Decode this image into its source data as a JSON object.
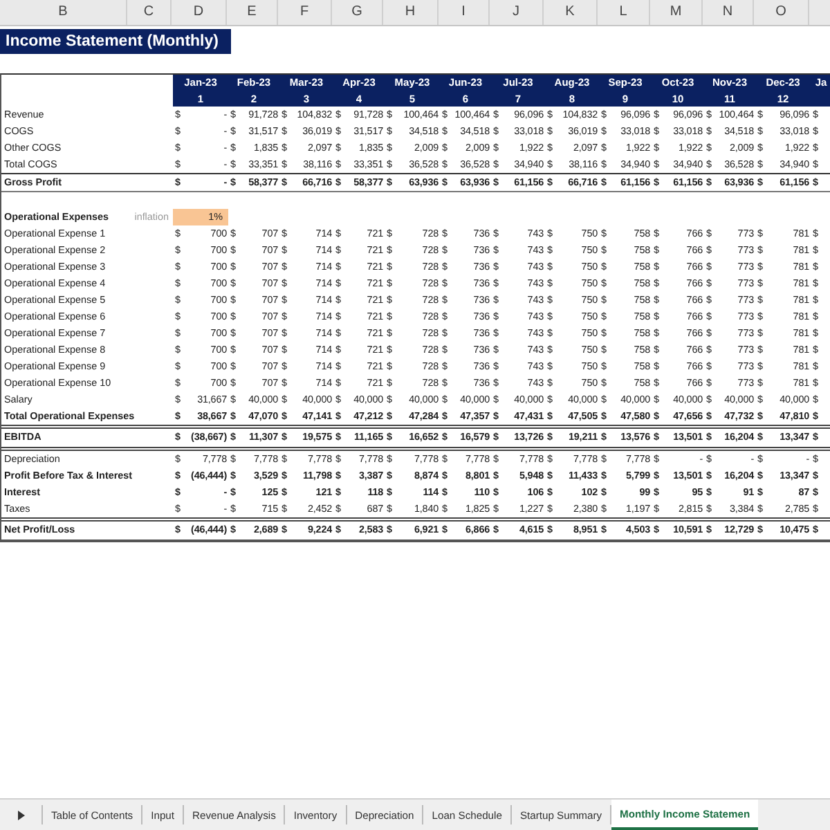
{
  "column_letters": [
    "B",
    "C",
    "D",
    "E",
    "F",
    "G",
    "H",
    "I",
    "J",
    "K",
    "L",
    "M",
    "N",
    "O"
  ],
  "title": "Income Statement (Monthly)",
  "table": {
    "months": [
      "Jan-23",
      "Feb-23",
      "Mar-23",
      "Apr-23",
      "May-23",
      "Jun-23",
      "Jul-23",
      "Aug-23",
      "Sep-23",
      "Oct-23",
      "Nov-23",
      "Dec-23",
      "Ja"
    ],
    "periods": [
      "1",
      "2",
      "3",
      "4",
      "5",
      "6",
      "7",
      "8",
      "9",
      "10",
      "11",
      "12"
    ],
    "rows": [
      {
        "label": "Revenue",
        "kind": "plain",
        "cells": [
          "$ -",
          "$ 91,728",
          "$ 104,832",
          "$ 91,728",
          "$ 100,464",
          "$ 100,464",
          "$ 96,096",
          "$ 104,832",
          "$ 96,096",
          "$ 96,096",
          "$ 100,464",
          "$ 96,096",
          "$"
        ]
      },
      {
        "label": "COGS",
        "kind": "plain",
        "cells": [
          "$ -",
          "$ 31,517",
          "$ 36,019",
          "$ 31,517",
          "$ 34,518",
          "$ 34,518",
          "$ 33,018",
          "$ 36,019",
          "$ 33,018",
          "$ 33,018",
          "$ 34,518",
          "$ 33,018",
          "$"
        ]
      },
      {
        "label": "Other COGS",
        "kind": "plain",
        "cells": [
          "$ -",
          "$ 1,835",
          "$ 2,097",
          "$ 1,835",
          "$ 2,009",
          "$ 2,009",
          "$ 1,922",
          "$ 2,097",
          "$ 1,922",
          "$ 1,922",
          "$ 2,009",
          "$ 1,922",
          "$"
        ]
      },
      {
        "label": "Total COGS",
        "kind": "plain",
        "cells": [
          "$ -",
          "$ 33,351",
          "$ 38,116",
          "$ 33,351",
          "$ 36,528",
          "$ 36,528",
          "$ 34,940",
          "$ 38,116",
          "$ 34,940",
          "$ 34,940",
          "$ 36,528",
          "$ 34,940",
          "$"
        ]
      },
      {
        "label": "Gross Profit",
        "kind": "total",
        "cells": [
          "$ -",
          "$ 58,377",
          "$ 66,716",
          "$ 58,377",
          "$ 63,936",
          "$ 63,936",
          "$ 61,156",
          "$ 66,716",
          "$ 61,156",
          "$ 61,156",
          "$ 63,936",
          "$ 61,156",
          "$"
        ]
      },
      {
        "label": "Operational Expenses",
        "kind": "section",
        "note": "inflation",
        "input": "1%"
      },
      {
        "label": "Operational Expense 1",
        "kind": "plain",
        "cells": [
          "$ 700",
          "$ 707",
          "$ 714",
          "$ 721",
          "$ 728",
          "$ 736",
          "$ 743",
          "$ 750",
          "$ 758",
          "$ 766",
          "$ 773",
          "$ 781",
          "$"
        ]
      },
      {
        "label": "Operational Expense 2",
        "kind": "plain",
        "cells": [
          "$ 700",
          "$ 707",
          "$ 714",
          "$ 721",
          "$ 728",
          "$ 736",
          "$ 743",
          "$ 750",
          "$ 758",
          "$ 766",
          "$ 773",
          "$ 781",
          "$"
        ]
      },
      {
        "label": "Operational Expense 3",
        "kind": "plain",
        "cells": [
          "$ 700",
          "$ 707",
          "$ 714",
          "$ 721",
          "$ 728",
          "$ 736",
          "$ 743",
          "$ 750",
          "$ 758",
          "$ 766",
          "$ 773",
          "$ 781",
          "$"
        ]
      },
      {
        "label": "Operational Expense 4",
        "kind": "plain",
        "cells": [
          "$ 700",
          "$ 707",
          "$ 714",
          "$ 721",
          "$ 728",
          "$ 736",
          "$ 743",
          "$ 750",
          "$ 758",
          "$ 766",
          "$ 773",
          "$ 781",
          "$"
        ]
      },
      {
        "label": "Operational Expense 5",
        "kind": "plain",
        "cells": [
          "$ 700",
          "$ 707",
          "$ 714",
          "$ 721",
          "$ 728",
          "$ 736",
          "$ 743",
          "$ 750",
          "$ 758",
          "$ 766",
          "$ 773",
          "$ 781",
          "$"
        ]
      },
      {
        "label": "Operational Expense 6",
        "kind": "plain",
        "cells": [
          "$ 700",
          "$ 707",
          "$ 714",
          "$ 721",
          "$ 728",
          "$ 736",
          "$ 743",
          "$ 750",
          "$ 758",
          "$ 766",
          "$ 773",
          "$ 781",
          "$"
        ]
      },
      {
        "label": "Operational Expense 7",
        "kind": "plain",
        "cells": [
          "$ 700",
          "$ 707",
          "$ 714",
          "$ 721",
          "$ 728",
          "$ 736",
          "$ 743",
          "$ 750",
          "$ 758",
          "$ 766",
          "$ 773",
          "$ 781",
          "$"
        ]
      },
      {
        "label": "Operational Expense 8",
        "kind": "plain",
        "cells": [
          "$ 700",
          "$ 707",
          "$ 714",
          "$ 721",
          "$ 728",
          "$ 736",
          "$ 743",
          "$ 750",
          "$ 758",
          "$ 766",
          "$ 773",
          "$ 781",
          "$"
        ]
      },
      {
        "label": "Operational Expense 9",
        "kind": "plain",
        "cells": [
          "$ 700",
          "$ 707",
          "$ 714",
          "$ 721",
          "$ 728",
          "$ 736",
          "$ 743",
          "$ 750",
          "$ 758",
          "$ 766",
          "$ 773",
          "$ 781",
          "$"
        ]
      },
      {
        "label": "Operational Expense 10",
        "kind": "plain",
        "cells": [
          "$ 700",
          "$ 707",
          "$ 714",
          "$ 721",
          "$ 728",
          "$ 736",
          "$ 743",
          "$ 750",
          "$ 758",
          "$ 766",
          "$ 773",
          "$ 781",
          "$"
        ]
      },
      {
        "label": "Salary",
        "kind": "plain",
        "cells": [
          "$ 31,667",
          "$ 40,000",
          "$ 40,000",
          "$ 40,000",
          "$ 40,000",
          "$ 40,000",
          "$ 40,000",
          "$ 40,000",
          "$ 40,000",
          "$ 40,000",
          "$ 40,000",
          "$ 40,000",
          "$"
        ]
      },
      {
        "label": "Total Operational Expenses",
        "kind": "bold",
        "cells": [
          "$ 38,667",
          "$ 47,070",
          "$ 47,141",
          "$ 47,212",
          "$ 47,284",
          "$ 47,357",
          "$ 47,431",
          "$ 47,505",
          "$ 47,580",
          "$ 47,656",
          "$ 47,732",
          "$ 47,810",
          "$"
        ]
      },
      {
        "label": "EBITDA",
        "kind": "double",
        "cells": [
          "$ (38,667)",
          "$ 11,307",
          "$ 19,575",
          "$ 11,165",
          "$ 16,652",
          "$ 16,579",
          "$ 13,726",
          "$ 19,211",
          "$ 13,576",
          "$ 13,501",
          "$ 16,204",
          "$ 13,347",
          "$"
        ]
      },
      {
        "label": "Depreciation",
        "kind": "plain",
        "cells": [
          "$ 7,778",
          "$ 7,778",
          "$ 7,778",
          "$ 7,778",
          "$ 7,778",
          "$ 7,778",
          "$ 7,778",
          "$ 7,778",
          "$ 7,778",
          "$ -",
          "$ -",
          "$ -",
          "$"
        ]
      },
      {
        "label": "Profit Before Tax & Interest",
        "kind": "bold",
        "cells": [
          "$ (46,444)",
          "$ 3,529",
          "$ 11,798",
          "$ 3,387",
          "$ 8,874",
          "$ 8,801",
          "$ 5,948",
          "$ 11,433",
          "$ 5,799",
          "$ 13,501",
          "$ 16,204",
          "$ 13,347",
          "$"
        ]
      },
      {
        "label": "Interest",
        "kind": "bold",
        "cells": [
          "$ -",
          "$ 125",
          "$ 121",
          "$ 118",
          "$ 114",
          "$ 110",
          "$ 106",
          "$ 102",
          "$ 99",
          "$ 95",
          "$ 91",
          "$ 87",
          "$"
        ]
      },
      {
        "label": "Taxes",
        "kind": "plain",
        "cells": [
          "$ -",
          "$ 715",
          "$ 2,452",
          "$ 687",
          "$ 1,840",
          "$ 1,825",
          "$ 1,227",
          "$ 2,380",
          "$ 1,197",
          "$ 2,815",
          "$ 3,384",
          "$ 2,785",
          "$"
        ]
      },
      {
        "label": "Net Profit/Loss",
        "kind": "final",
        "cells": [
          "$ (46,444)",
          "$ 2,689",
          "$ 9,224",
          "$ 2,583",
          "$ 6,921",
          "$ 6,866",
          "$ 4,615",
          "$ 8,951",
          "$ 4,503",
          "$ 10,591",
          "$ 12,729",
          "$ 10,475",
          "$"
        ]
      }
    ]
  },
  "sheet_tabs": [
    {
      "label": "Table of Contents",
      "selected": false
    },
    {
      "label": "Input",
      "selected": false
    },
    {
      "label": "Revenue Analysis",
      "selected": false
    },
    {
      "label": "Inventory",
      "selected": false
    },
    {
      "label": "Depreciation",
      "selected": false
    },
    {
      "label": "Loan Schedule",
      "selected": false
    },
    {
      "label": "Startup Summary",
      "selected": false
    },
    {
      "label": "Monthly Income Statemen",
      "selected": true
    }
  ]
}
